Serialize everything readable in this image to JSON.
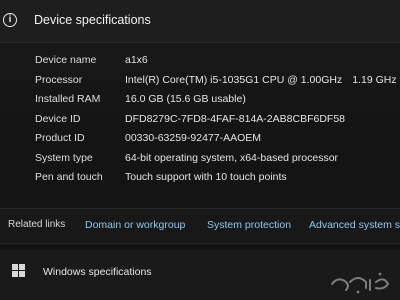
{
  "header": {
    "icon": "info-icon",
    "title": "Device specifications"
  },
  "specs": [
    {
      "label": "Device name",
      "value": "a1x6",
      "extra": ""
    },
    {
      "label": "Processor",
      "value": "Intel(R) Core(TM) i5-1035G1 CPU @ 1.00GHz",
      "extra": "1.19 GHz"
    },
    {
      "label": "Installed RAM",
      "value": "16.0 GB (15.6 GB usable)",
      "extra": ""
    },
    {
      "label": "Device ID",
      "value": "DFD8279C-7FD8-4FAF-814A-2AB8CBF6DF58",
      "extra": ""
    },
    {
      "label": "Product ID",
      "value": "00330-63259-92477-AAOEM",
      "extra": ""
    },
    {
      "label": "System type",
      "value": "64-bit operating system, x64-based processor",
      "extra": ""
    },
    {
      "label": "Pen and touch",
      "value": "Touch support with 10 touch points",
      "extra": ""
    }
  ],
  "related": {
    "label": "Related links",
    "links": [
      "Domain or workgroup",
      "System protection",
      "Advanced system set"
    ]
  },
  "windows": {
    "icon": "windows-logo-icon",
    "title": "Windows specifications"
  },
  "watermark": {
    "icon": "haraj-logo-icon",
    "text": "حراج"
  },
  "colors": {
    "background": "#141414",
    "link": "#8ec8f0",
    "text": "#e6e6e6"
  }
}
